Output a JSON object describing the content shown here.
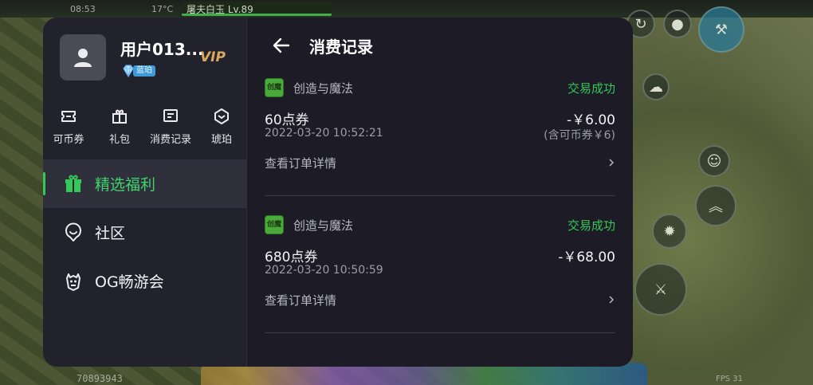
{
  "game": {
    "time": "08:53",
    "temp": "17°C",
    "player": "屠夫白玉 Lv.89",
    "player_id": "70893943",
    "fps": "FPS 31"
  },
  "colors": {
    "accent_green": "#34c759",
    "panel_bg": "#1c1b26",
    "vip_gold": "#d9a85c"
  },
  "profile": {
    "username": "用户013...",
    "vip": "VIP",
    "badge": "蓝珀"
  },
  "quick_actions": [
    {
      "label": "可币券",
      "icon": "ticket-icon"
    },
    {
      "label": "礼包",
      "icon": "gift-icon"
    },
    {
      "label": "消费记录",
      "icon": "receipt-icon"
    },
    {
      "label": "琥珀",
      "icon": "amber-icon"
    }
  ],
  "nav": [
    {
      "label": "精选福利",
      "icon": "gift-icon",
      "active": true
    },
    {
      "label": "社区",
      "icon": "community-icon",
      "active": false
    },
    {
      "label": "OG畅游会",
      "icon": "og-club-icon",
      "active": false
    }
  ],
  "page": {
    "title": "消费记录",
    "detail_label": "查看订单详情"
  },
  "records": [
    {
      "app_icon_text": "创魔",
      "app_name": "创造与魔法",
      "status": "交易成功",
      "item": "60点券",
      "amount": "-￥6.00",
      "time": "2022-03-20 10:52:21",
      "note": "(含可币券￥6)"
    },
    {
      "app_icon_text": "创魔",
      "app_name": "创造与魔法",
      "status": "交易成功",
      "item": "680点券",
      "amount": "-￥68.00",
      "time": "2022-03-20 10:50:59",
      "note": ""
    }
  ]
}
